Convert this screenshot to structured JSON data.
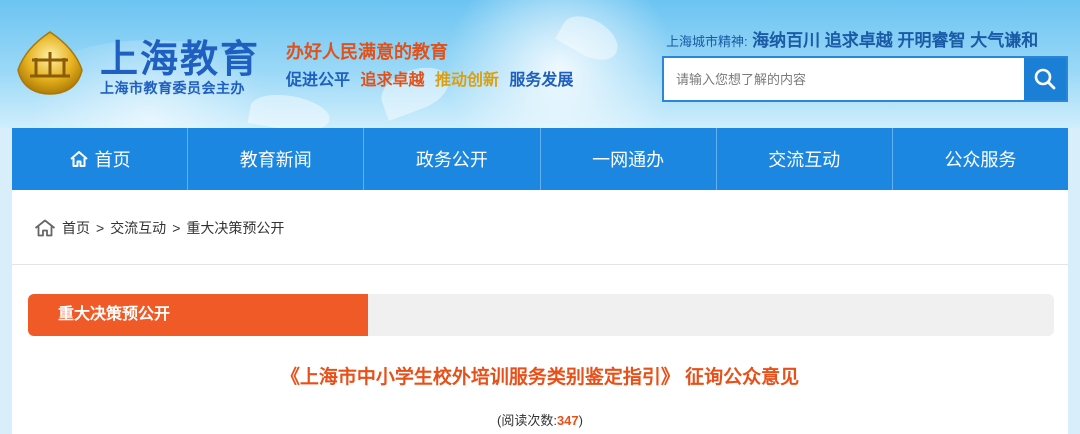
{
  "header": {
    "site_title": "上海教育",
    "site_subtitle": "上海市教育委员会主办",
    "slogan_line1": "办好人民满意的教育",
    "slogan_line2": [
      "促进公平",
      "追求卓越",
      "推动创新",
      "服务发展"
    ],
    "spirit_label": "上海城市精神:",
    "spirit_value": "海纳百川 追求卓越 开明睿智 大气谦和",
    "search_placeholder": "请输入您想了解的内容",
    "colors": {
      "brand_blue": "#1f5fbf",
      "accent_orange": "#e0521c",
      "nav_blue": "#1b87e0"
    }
  },
  "nav": {
    "items": [
      {
        "label": "首页",
        "icon": "home-icon"
      },
      {
        "label": "教育新闻"
      },
      {
        "label": "政务公开"
      },
      {
        "label": "一网通办"
      },
      {
        "label": "交流互动"
      },
      {
        "label": "公众服务"
      }
    ]
  },
  "breadcrumb": {
    "icon": "home-icon",
    "items": [
      "首页",
      "交流互动",
      "重大决策预公开"
    ],
    "separator": ">"
  },
  "section": {
    "label": "重大决策预公开"
  },
  "article": {
    "title": "《上海市中小学生校外培训服务类别鉴定指引》 征询公众意见",
    "read_label": "(阅读次数:",
    "read_count": "347",
    "read_suffix": ")"
  }
}
